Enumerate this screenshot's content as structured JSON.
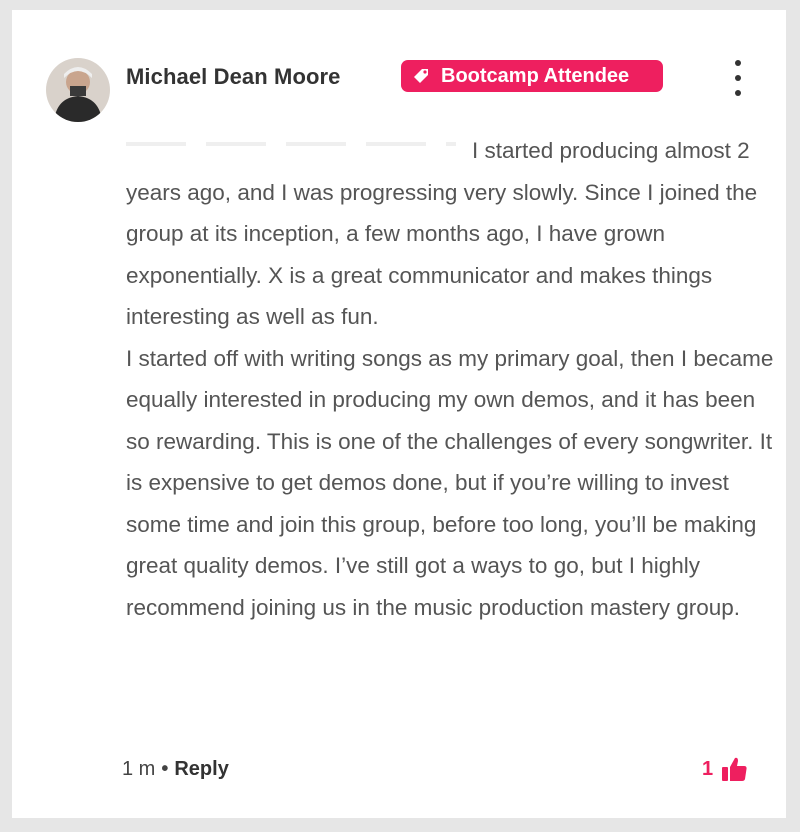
{
  "comment": {
    "author": "Michael Dean Moore",
    "badge": {
      "label": "Bootcamp Attendee",
      "icon": "tag-icon",
      "color": "#ee1f5f"
    },
    "more_icon": "vertical-ellipsis-icon",
    "paragraphs": [
      "I started producing almost 2 years ago, and I was progressing very slowly. Since I joined the group at its inception, a few months ago, I have grown exponentially. X is a great communicator and makes things interesting as well as fun.",
      "I started off with writing songs as my primary goal, then I became equally interested in producing my own demos, and it has been so rewarding. This is one of the challenges of every songwriter. It is expensive to get demos done, but if you’re willing to invest some time and join this group, before too long, you’ll be making great quality demos. I’ve still got a ways to go, but I highly recommend joining us in the music production mastery group."
    ],
    "timestamp": "1 m",
    "separator": "•",
    "reply_label": "Reply",
    "like_count": "1",
    "like_icon": "thumbs-up-icon"
  }
}
